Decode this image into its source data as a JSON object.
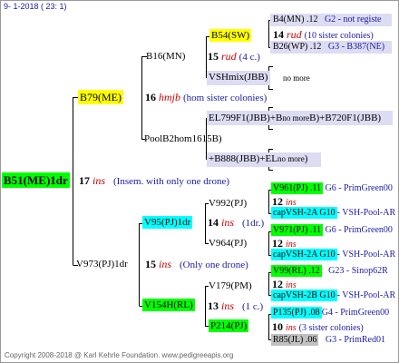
{
  "header": {
    "date": "9- 1-2018 ( 23: 1)"
  },
  "footer": {
    "text": "Copyright 2008-2018 @ Karl Kehrle Foundation.   www.pedigreeapis.org"
  },
  "colors": {
    "green": "#00ff00",
    "cyan": "#00ffff",
    "yellow": "#ffff00",
    "grey": "#c0c0c0",
    "band": "#dcdcf2",
    "red": "#cc0000",
    "blue": "#1a1aa6"
  },
  "root": {
    "label": "B51(ME)1dr",
    "num": "17",
    "ins": "ins",
    "note": "(Insem. with only one drone)"
  },
  "b79": {
    "label": "B79(ME)",
    "num": "16",
    "ins": "hmjb",
    "note": "(hom sister colonies)"
  },
  "b16": {
    "label": "B16(MN)",
    "num": "15",
    "ins": "rud",
    "note": "(4 c.)"
  },
  "b54": {
    "label": "B54(SW)",
    "num": "14",
    "ins": "rud",
    "note": "(10 sister colonies)",
    "sire_label": "B4(MN) .12",
    "sire_code": "G2 - not registe",
    "dam_label": "B26(WP) .12",
    "dam_code": "G3 - B387(NE)"
  },
  "vshmix": {
    "label": "VSHmix(JBB)",
    "note": "no more"
  },
  "poolb2": {
    "label": "PoolB2hom1615B)",
    "e1": "EL799F1(JBB)+B",
    "e1a": "no more",
    "e1b": "B)+B720F1(JBB)",
    "e2": "+B888(JBB)+EL",
    "e2a": "no more",
    "e2b": ")"
  },
  "v973": {
    "label": "V973(PJ)1dr",
    "num": "15",
    "ins": "ins",
    "note": "(Only one drone)"
  },
  "v95": {
    "label": "V95(PJ)1dr",
    "num": "14",
    "ins": "ins",
    "note": "(1dr.)"
  },
  "v992": {
    "label": "V992(PJ)",
    "num": "12",
    "ins": "ins",
    "s1": "V961(PJ) .11",
    "s1c": "G6 - PrimGreen00",
    "s2": "capVSH-2A G10",
    "s2c": "- VSH-Pool-AR"
  },
  "v964": {
    "label": "V964(PJ)",
    "num": "12",
    "ins": "ins",
    "s1": "V971(PJ) .11",
    "s1c": "G6 - PrimGreen00",
    "s2": "capVSH-2A G10",
    "s2c": "- VSH-Pool-AR"
  },
  "v154": {
    "label": "V154H(RL)",
    "num": "13",
    "ins": "ins",
    "note": "(1 c.)"
  },
  "v179": {
    "label": "V179(PM)",
    "num": "12",
    "ins": "ins",
    "s1": "V99(RL) .12",
    "s1c": "G23 - Sinop62R",
    "s2": "capVSH-2B G10",
    "s2c": "- VSH-Pool-AR"
  },
  "p214": {
    "label": "P214(PJ)",
    "num": "10",
    "ins": "ins",
    "note": "(3 sister colonies)",
    "s1": "P135(PJ) .08",
    "s1c": "G4 - PrimGreen00",
    "s2": "R85(JL) .06",
    "s2c": "G3 - PrimRed01"
  }
}
